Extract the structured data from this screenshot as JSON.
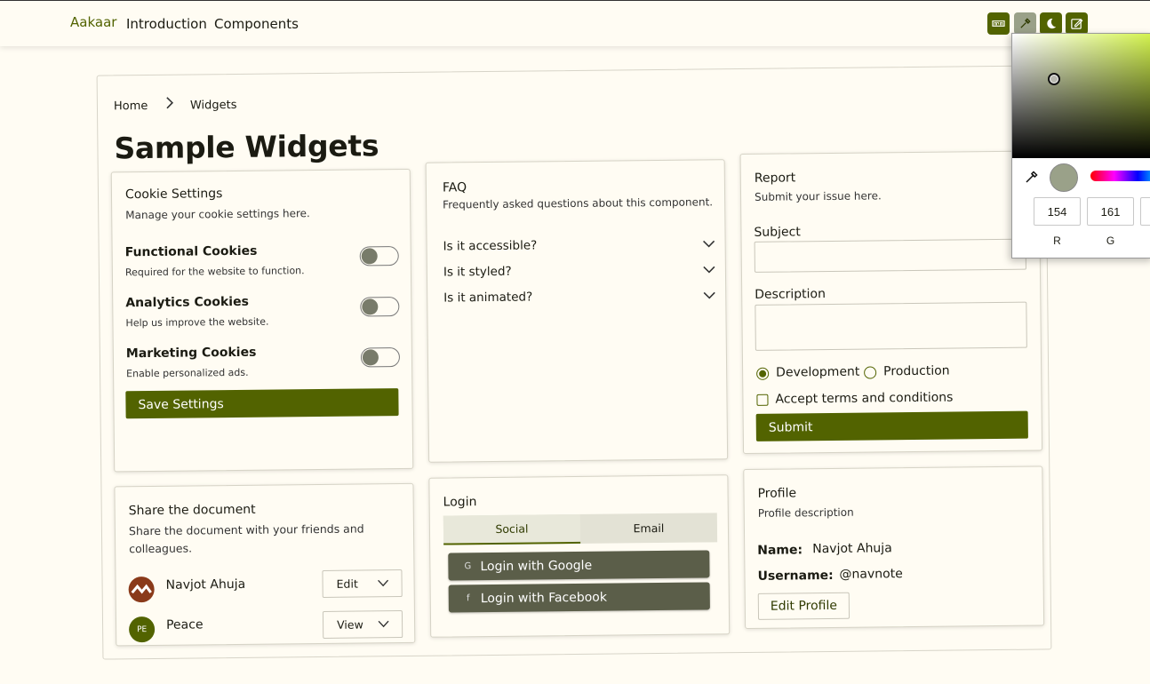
{
  "header": {
    "logo": "Aakaar",
    "nav": [
      "Introduction",
      "Components"
    ],
    "tool_buttons": [
      "npm-icon",
      "color-picker-icon",
      "moon-icon",
      "edit-icon"
    ]
  },
  "breadcrumb": {
    "home": "Home",
    "current": "Widgets"
  },
  "page_title": "Sample Widgets",
  "cookie": {
    "title": "Cookie Settings",
    "subtitle": "Manage your cookie settings here.",
    "items": [
      {
        "title": "Functional Cookies",
        "desc": "Required for the website to function."
      },
      {
        "title": "Analytics Cookies",
        "desc": "Help us improve the website."
      },
      {
        "title": "Marketing Cookies",
        "desc": "Enable personalized ads."
      }
    ],
    "save_label": "Save Settings"
  },
  "faq": {
    "title": "FAQ",
    "subtitle": "Frequently asked questions about this component.",
    "questions": [
      "Is it accessible?",
      "Is it styled?",
      "Is it animated?"
    ]
  },
  "report": {
    "title": "Report",
    "subtitle": "Submit your issue here.",
    "subject_label": "Subject",
    "description_label": "Description",
    "env_options": [
      "Development",
      "Production"
    ],
    "env_selected": "Development",
    "terms_label": "Accept terms and conditions",
    "submit_label": "Submit"
  },
  "share": {
    "title": "Share the document",
    "subtitle_line1": "Share the document with your friends and",
    "subtitle_line2": "colleagues.",
    "people": [
      {
        "name": "Navjot Ahuja",
        "permission": "Edit",
        "initials": ""
      },
      {
        "name": "Peace",
        "permission": "View",
        "initials": "PE"
      }
    ]
  },
  "login": {
    "title": "Login",
    "tabs": [
      "Social",
      "Email"
    ],
    "active_tab": "Social",
    "google_label": "Login with Google",
    "facebook_label": "Login with Facebook"
  },
  "profile": {
    "title": "Profile",
    "subtitle": "Profile description",
    "name_key": "Name:",
    "name_value": "Navjot Ahuja",
    "username_key": "Username:",
    "username_value": "@navnote",
    "edit_label": "Edit Profile"
  },
  "color_picker": {
    "r": "154",
    "g": "161",
    "r_label": "R",
    "g_label": "G",
    "color": "#9aa189"
  },
  "colors": {
    "accent": "#526300",
    "background": "#fffcf3",
    "social_button": "#5b5e49"
  }
}
